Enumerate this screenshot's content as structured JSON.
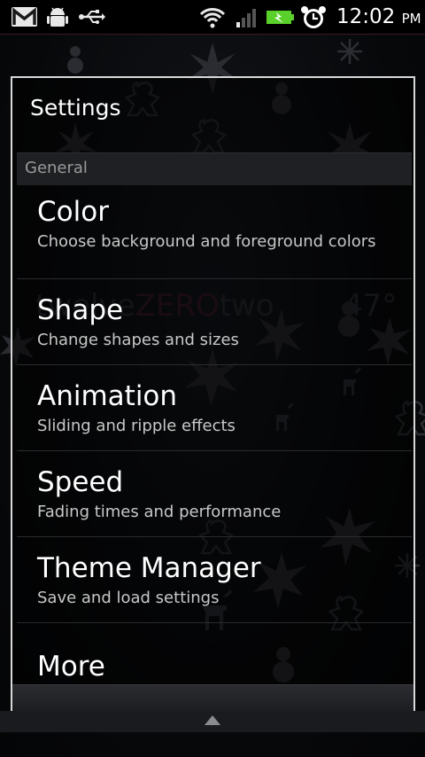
{
  "status_bar": {
    "time": "12:02",
    "ampm": "PM",
    "icons": [
      "gmail-icon",
      "android-debug-icon",
      "usb-icon",
      "wifi-icon",
      "signal-icon",
      "battery-charging-icon",
      "alarm-icon"
    ]
  },
  "wallpaper": {
    "clock_part1": "twelve",
    "clock_part2": "ZERO",
    "clock_part3": "two",
    "temperature": "47°"
  },
  "settings": {
    "title": "Settings",
    "category": "General",
    "items": [
      {
        "title": "Color",
        "summary": "Choose background and foreground colors"
      },
      {
        "title": "Shape",
        "summary": "Change shapes and sizes"
      },
      {
        "title": "Animation",
        "summary": "Sliding and ripple effects"
      },
      {
        "title": "Speed",
        "summary": "Fading times and performance"
      },
      {
        "title": "Theme Manager",
        "summary": "Save and load settings"
      },
      {
        "title": "More",
        "summary": ""
      }
    ]
  },
  "colors": {
    "accent_zero": "#3a1c2c",
    "panel_border": "#d9d9d9",
    "charging_green": "#5ad12a"
  }
}
